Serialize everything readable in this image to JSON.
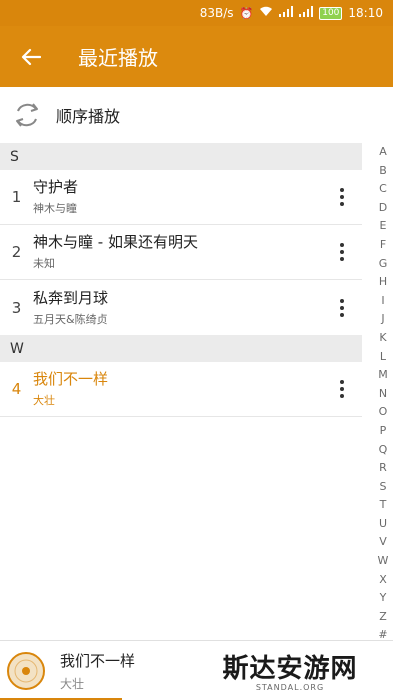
{
  "status_bar": {
    "speed": "83B/s",
    "battery": "100",
    "time": "18:10"
  },
  "toolbar": {
    "title": "最近播放"
  },
  "play_mode": {
    "label": "顺序播放"
  },
  "sections": [
    {
      "letter": "S",
      "songs": [
        {
          "num": "1",
          "title": "守护者",
          "artist": "神木与瞳",
          "playing": false
        },
        {
          "num": "2",
          "title": "神木与瞳 - 如果还有明天",
          "artist": "未知",
          "playing": false
        },
        {
          "num": "3",
          "title": "私奔到月球",
          "artist": "五月天&陈绮贞",
          "playing": false
        }
      ]
    },
    {
      "letter": "W",
      "songs": [
        {
          "num": "4",
          "title": "我们不一样",
          "artist": "大壮",
          "playing": true
        }
      ]
    }
  ],
  "alphabet": [
    "A",
    "B",
    "C",
    "D",
    "E",
    "F",
    "G",
    "H",
    "I",
    "J",
    "K",
    "L",
    "M",
    "N",
    "O",
    "P",
    "Q",
    "R",
    "S",
    "T",
    "U",
    "V",
    "W",
    "X",
    "Y",
    "Z",
    "#"
  ],
  "now_playing": {
    "title": "我们不一样",
    "artist": "大壮",
    "progress": 0.31
  },
  "watermark": {
    "text": "斯达安游网",
    "sub": "STANDAL.ORG"
  },
  "colors": {
    "accent": "#d9860c",
    "section_bg": "#ebebeb"
  }
}
